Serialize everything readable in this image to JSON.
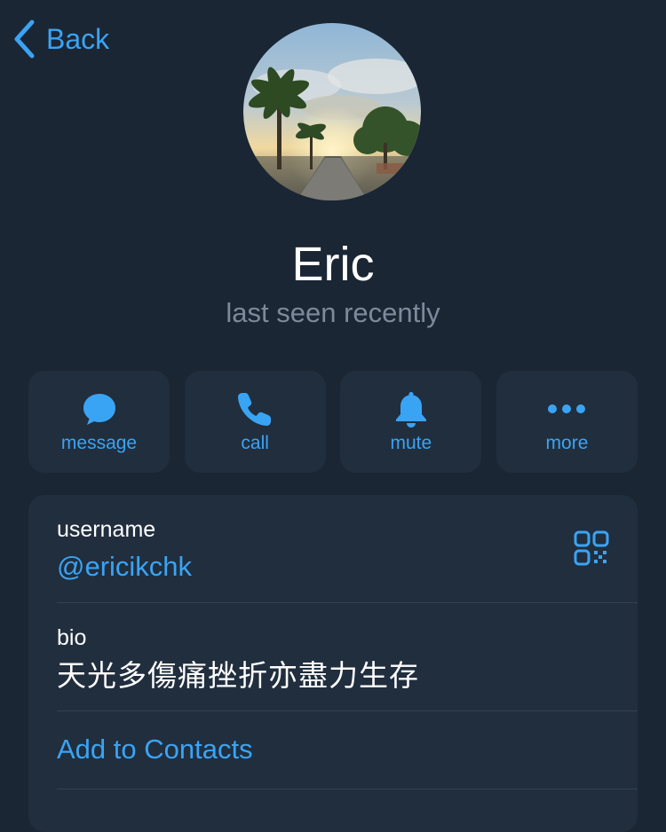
{
  "nav": {
    "back_label": "Back"
  },
  "profile": {
    "avatar_icon": "profile-photo-palm-street-sunset",
    "name": "Eric",
    "status": "last seen recently"
  },
  "actions": [
    {
      "label": "message",
      "icon": "chat-bubble-icon"
    },
    {
      "label": "call",
      "icon": "phone-icon"
    },
    {
      "label": "mute",
      "icon": "bell-icon"
    },
    {
      "label": "more",
      "icon": "ellipsis-icon"
    }
  ],
  "info": {
    "username_label": "username",
    "username_value": "@ericikchk",
    "qr_icon": "qr-code-icon",
    "bio_label": "bio",
    "bio_value": "天光多傷痛挫折亦盡力生存",
    "add_contact_label": "Add to Contacts"
  },
  "colors": {
    "background": "#1b2634",
    "card": "#212e3e",
    "accent": "#3aa4f4",
    "secondary_text": "#7c8a9b",
    "separator": "#35424f"
  }
}
